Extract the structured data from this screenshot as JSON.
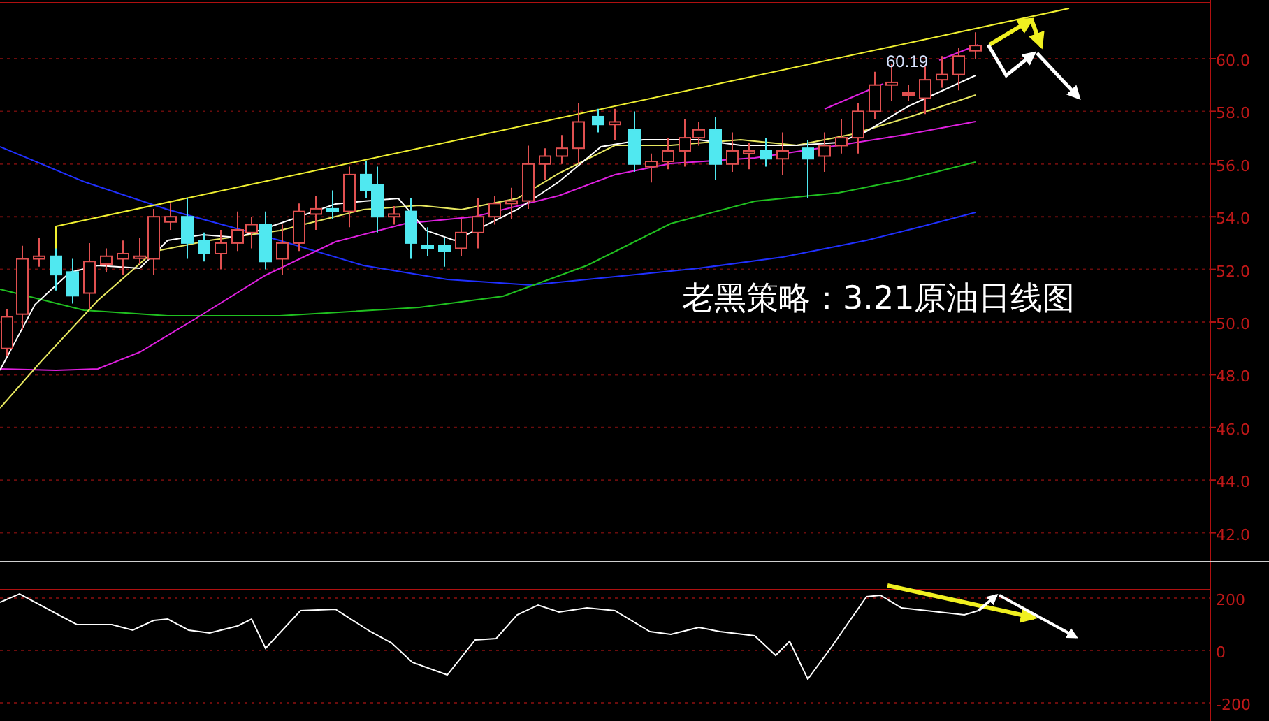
{
  "title": "老黑策略：3.21原油日线图",
  "price_label": "60.19",
  "price_axis": {
    "ticks": [
      "60.0",
      "58.0",
      "56.0",
      "54.0",
      "52.0",
      "50.0",
      "48.0",
      "46.0",
      "44.0",
      "42.0"
    ]
  },
  "oscillator_axis": {
    "ticks": [
      "200",
      "0",
      "-200"
    ]
  }
}
